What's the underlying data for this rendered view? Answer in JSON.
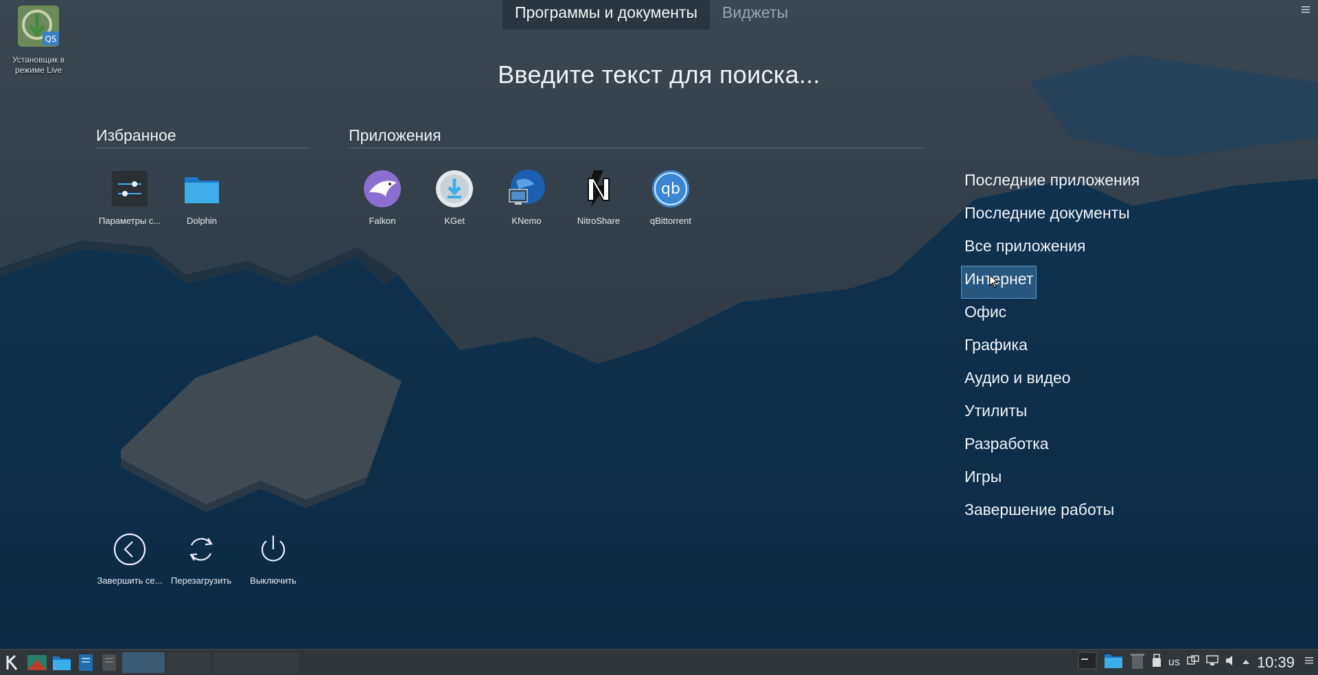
{
  "desktop": {
    "installer_label": "Установщик в режиме Live"
  },
  "tabs": [
    {
      "label": "Программы и документы",
      "active": true
    },
    {
      "label": "Виджеты",
      "active": false
    }
  ],
  "search": {
    "placeholder": "Введите текст для поиска..."
  },
  "favorites": {
    "title": "Избранное",
    "items": [
      {
        "label": "Параметры с...",
        "icon": "settings-sliders-icon"
      },
      {
        "label": "Dolphin",
        "icon": "folder-icon"
      }
    ]
  },
  "applications": {
    "title": "Приложения",
    "items": [
      {
        "label": "Falkon",
        "icon": "falkon-icon"
      },
      {
        "label": "KGet",
        "icon": "kget-icon"
      },
      {
        "label": "KNemo",
        "icon": "knemo-icon"
      },
      {
        "label": "NitroShare",
        "icon": "nitroshare-icon"
      },
      {
        "label": "qBittorrent",
        "icon": "qbittorrent-icon"
      }
    ]
  },
  "categories": [
    "Последние приложения",
    "Последние документы",
    "Все приложения",
    "Интернет",
    "Офис",
    "Графика",
    "Аудио и видео",
    "Утилиты",
    "Разработка",
    "Игры",
    "Завершение работы"
  ],
  "hovered_category": "Интернет",
  "power": [
    {
      "label": "Завершить се...",
      "icon": "logout-icon"
    },
    {
      "label": "Перезагрузить",
      "icon": "restart-icon"
    },
    {
      "label": "Выключить",
      "icon": "shutdown-icon"
    }
  ],
  "taskbar": {
    "keyboard_layout": "us",
    "clock": "10:39"
  },
  "colors": {
    "accent": "#3daee9",
    "hover_bg": "#2c6a96",
    "taskbar": "#31363b"
  }
}
